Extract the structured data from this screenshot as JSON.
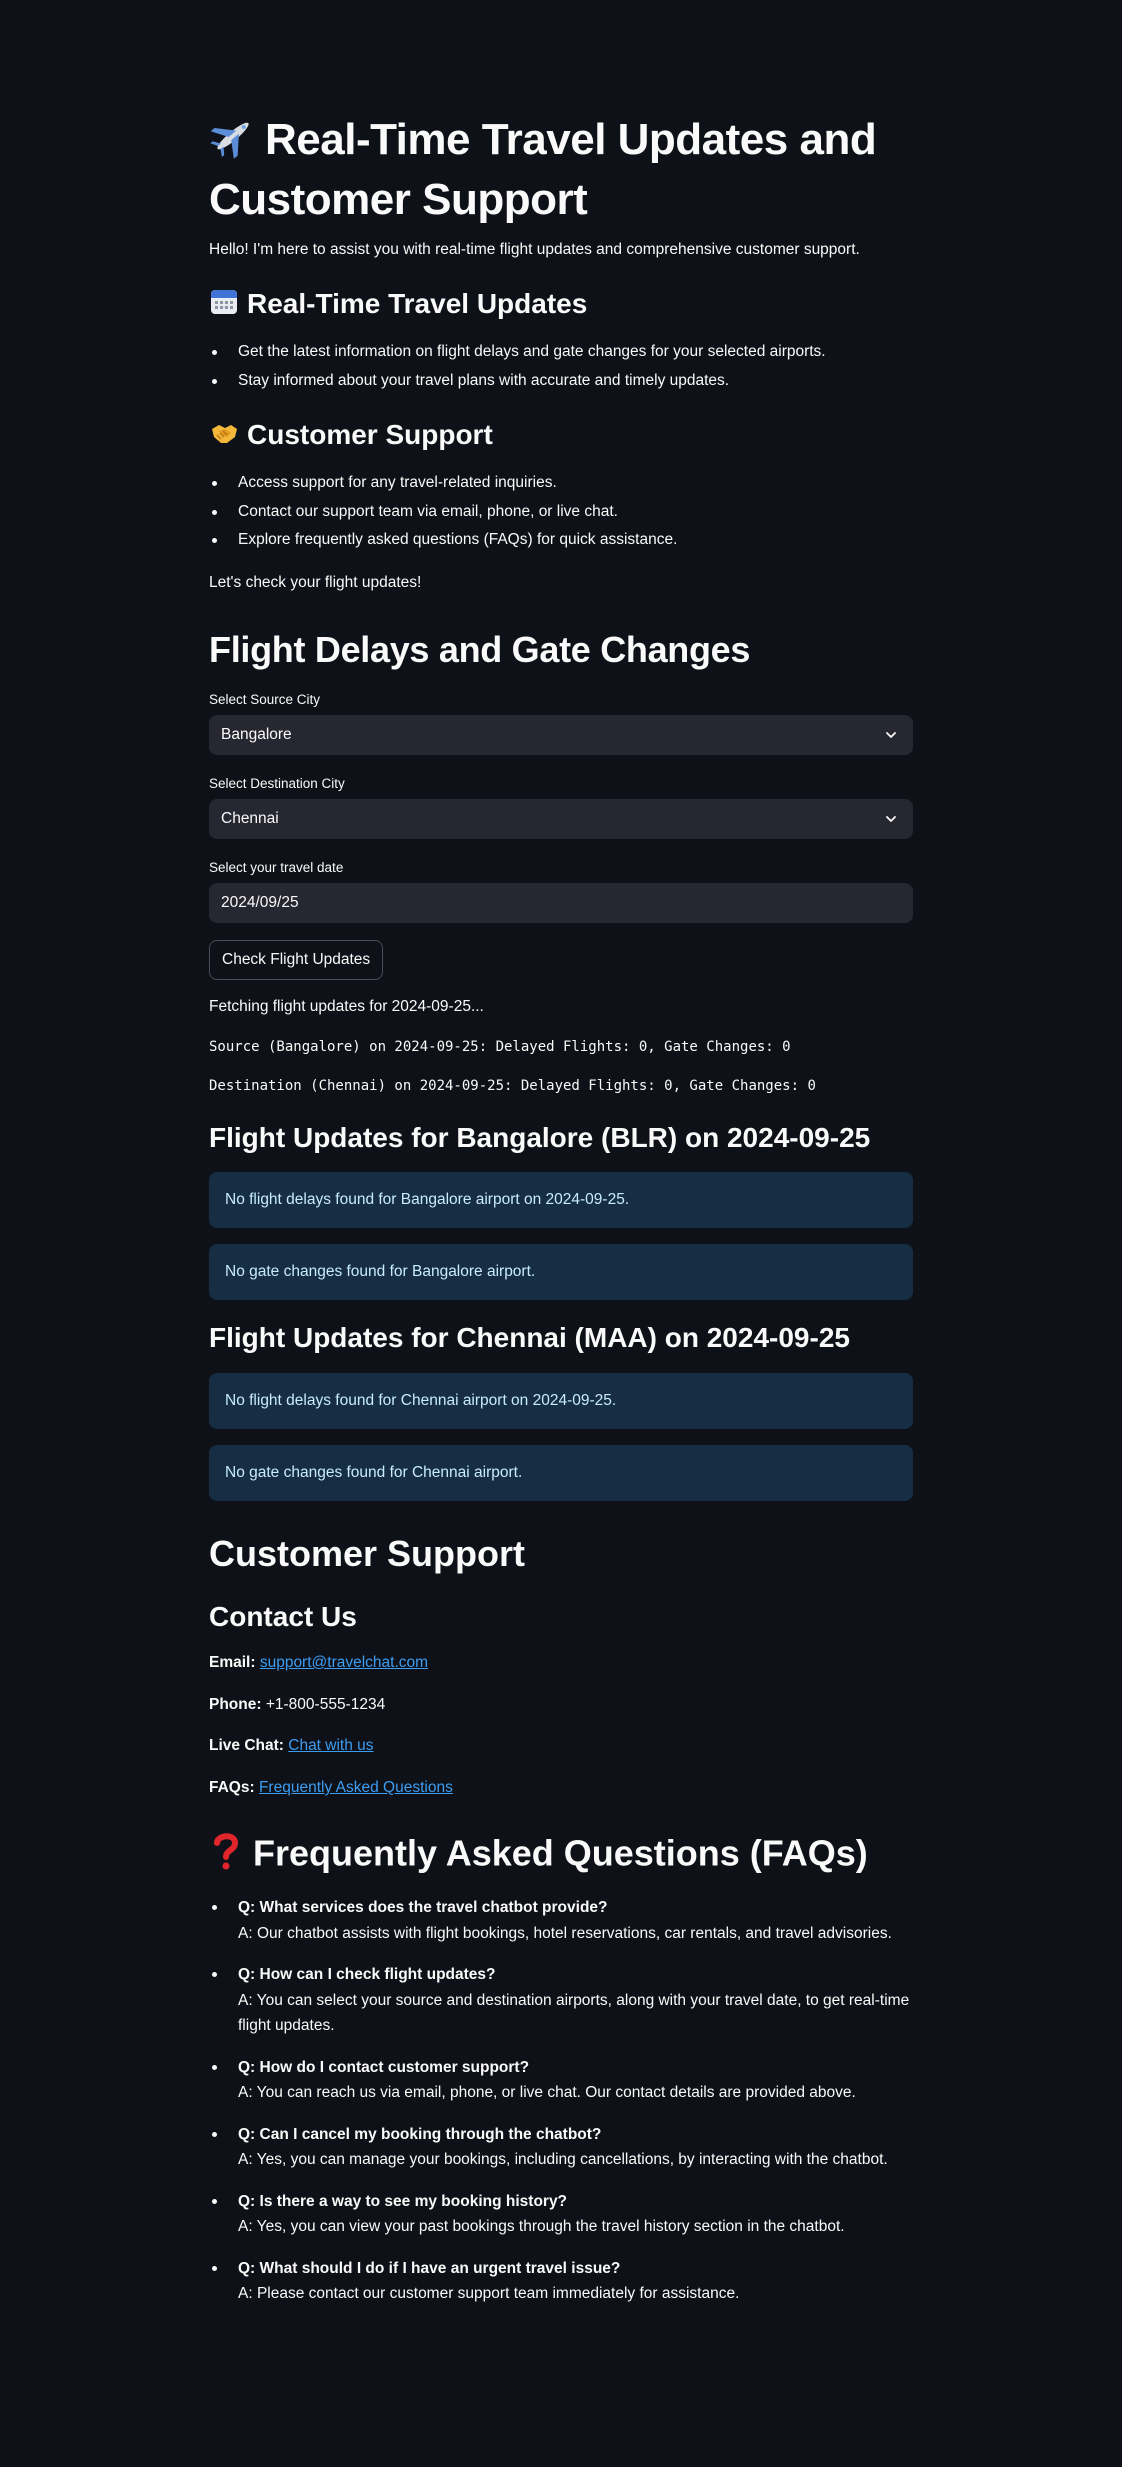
{
  "header": {
    "title": "Real-Time Travel Updates and Customer Support",
    "title_icon": "airplane-icon",
    "intro": "Hello! I'm here to assist you with real-time flight updates and comprehensive customer support."
  },
  "travel_updates_section": {
    "heading": "Real-Time Travel Updates",
    "icon": "calendar-icon",
    "bullets": [
      "Get the latest information on flight delays and gate changes for your selected airports.",
      "Stay informed about your travel plans with accurate and timely updates."
    ]
  },
  "support_section": {
    "heading": "Customer Support",
    "icon": "handshake-icon",
    "bullets": [
      "Access support for any travel-related inquiries.",
      "Contact our support team via email, phone, or live chat.",
      "Explore frequently asked questions (FAQs) for quick assistance."
    ],
    "cta": "Let's check your flight updates!"
  },
  "flight_form": {
    "heading": "Flight Delays and Gate Changes",
    "source_label": "Select Source City",
    "source_value": "Bangalore",
    "destination_label": "Select Destination City",
    "destination_value": "Chennai",
    "date_label": "Select your travel date",
    "date_value": "2024/09/25",
    "button_label": "Check Flight Updates"
  },
  "results": {
    "fetching": "Fetching flight updates for 2024-09-25...",
    "source_summary": "Source (Bangalore) on 2024-09-25: Delayed Flights: 0, Gate Changes: 0",
    "destination_summary": "Destination (Chennai) on 2024-09-25: Delayed Flights: 0, Gate Changes: 0",
    "source_heading": "Flight Updates for Bangalore (BLR) on 2024-09-25",
    "source_delays": "No flight delays found for Bangalore airport on 2024-09-25.",
    "source_gates": "No gate changes found for Bangalore airport.",
    "dest_heading": "Flight Updates for Chennai (MAA) on 2024-09-25",
    "dest_delays": "No flight delays found for Chennai airport on 2024-09-25.",
    "dest_gates": "No gate changes found for Chennai airport.",
    "info_color": "#172d43",
    "info_text_color": "#c7ebff"
  },
  "contact": {
    "heading": "Customer Support",
    "subheading": "Contact Us",
    "email_label": "Email:",
    "email_value": "support@travelchat.com",
    "phone_label": "Phone:",
    "phone_value": "+1-800-555-1234",
    "chat_label": "Live Chat:",
    "chat_value": "Chat with us",
    "faqs_label": "FAQs:",
    "faqs_value": "Frequently Asked Questions",
    "link_color": "#3d9df3"
  },
  "faq": {
    "heading": "Frequently Asked Questions (FAQs)",
    "icon": "question-mark-icon",
    "items": [
      {
        "q": "Q: What services does the travel chatbot provide?",
        "a": "A: Our chatbot assists with flight bookings, hotel reservations, car rentals, and travel advisories."
      },
      {
        "q": "Q: How can I check flight updates?",
        "a": "A: You can select your source and destination airports, along with your travel date, to get real-time flight updates."
      },
      {
        "q": "Q: How do I contact customer support?",
        "a": "A: You can reach us via email, phone, or live chat. Our contact details are provided above."
      },
      {
        "q": "Q: Can I cancel my booking through the chatbot?",
        "a": "A: Yes, you can manage your bookings, including cancellations, by interacting with the chatbot."
      },
      {
        "q": "Q: Is there a way to see my booking history?",
        "a": "A: Yes, you can view your past bookings through the travel history section in the chatbot."
      },
      {
        "q": "Q: What should I do if I have an urgent travel issue?",
        "a": "A: Please contact our customer support team immediately for assistance."
      }
    ]
  },
  "theme": {
    "background": "#0e1117",
    "input_background": "#262730",
    "text": "#fafafa"
  }
}
